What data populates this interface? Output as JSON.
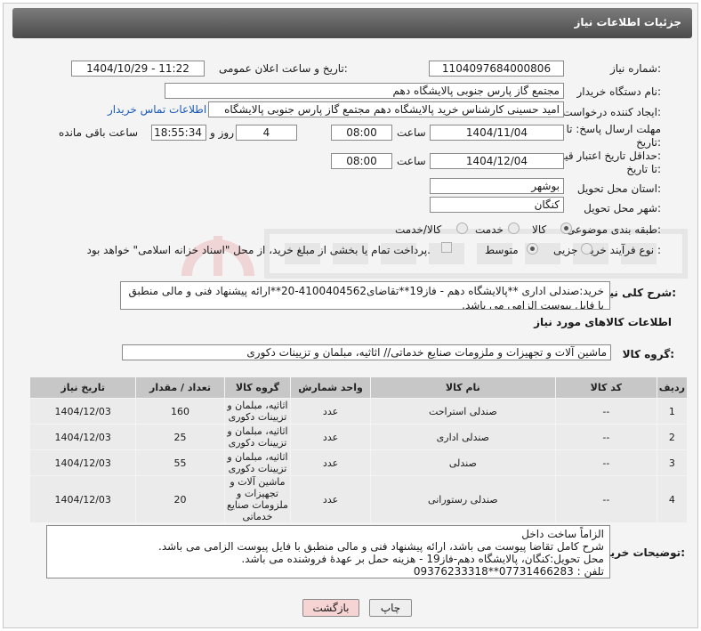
{
  "header": {
    "title": "جزئیات اطلاعات نیاز"
  },
  "form": {
    "need_number": {
      "label": "شماره نیاز:",
      "value": "1104097684000806"
    },
    "announce_datetime": {
      "label": "تاریخ و ساعت اعلان عمومی:",
      "value": "1404/10/29 - 11:22"
    },
    "buyer_org": {
      "label": "نام دستگاه خریدار:",
      "value": "مجتمع گاز پارس جنوبی  پالایشگاه دهم"
    },
    "requester": {
      "label": "ایجاد کننده درخواست:",
      "value": "امید حسینی کارشناس خرید پالایشگاه دهم  مجتمع گاز پارس جنوبی  پالایشگاه",
      "contact_link": "اطلاعات تماس خریدار"
    },
    "reply_deadline": {
      "label_line1": "مهلت ارسال پاسخ: تا",
      "label_line2": "تاریخ:",
      "date": "1404/11/04",
      "time_label": "ساعت",
      "time": "08:00",
      "days": "4",
      "days_label": "روز و",
      "remaining": "18:55:34",
      "remaining_label": "ساعت باقی مانده"
    },
    "price_validity": {
      "label_line1": "حداقل تاریخ اعتبار قیمت:",
      "label_line2": "تا تاریخ:",
      "date": "1404/12/04",
      "time_label": "ساعت",
      "time": "08:00"
    },
    "province": {
      "label": "استان محل تحویل:",
      "value": "بوشهر"
    },
    "city": {
      "label": "شهر محل تحویل:",
      "value": "کنگان"
    },
    "category": {
      "label": "طبقه بندی موضوعی:",
      "options": [
        "کالا",
        "خدمت",
        "کالا/خدمت"
      ],
      "selected": "کالا"
    },
    "process_type": {
      "label": "نوع فرآیند خرید :",
      "options": [
        "جزیی",
        "متوسط"
      ],
      "selected": "متوسط",
      "payment_note": "پرداخت تمام یا بخشی از مبلغ خرید، از محل \"اسناد خزانه اسلامی\" خواهد بود."
    }
  },
  "summary": {
    "label": "شرح کلی نیاز:",
    "text": "خرید:صندلی اداری **پالایشگاه دهم - فاز19**تقاضای4100404562-20**ارائه پیشنهاد فنی و مالی منطبق با فایل پیوست الزامی می باشد."
  },
  "goods_info": {
    "title": "اطلاعات کالاهای مورد نیاز"
  },
  "goods_group": {
    "label": "گروه کالا:",
    "value": "ماشین آلات و تجهیزات و ملزومات صنایع خدماتی// اثاثیه، مبلمان و تزیینات دکوری"
  },
  "table": {
    "headers": [
      "ردیف",
      "کد کالا",
      "نام کالا",
      "واحد شمارش",
      "گروه کالا",
      "تعداد / مقدار",
      "تاریخ نیاز"
    ],
    "rows": [
      {
        "row": "1",
        "code": "--",
        "name": "صندلی استراحت",
        "unit": "عدد",
        "group": "اثاثیه، مبلمان و تزیینات دکوری",
        "qty": "160",
        "date": "1404/12/03"
      },
      {
        "row": "2",
        "code": "--",
        "name": "صندلی اداری",
        "unit": "عدد",
        "group": "اثاثیه، مبلمان و تزیینات دکوری",
        "qty": "25",
        "date": "1404/12/03"
      },
      {
        "row": "3",
        "code": "--",
        "name": "صندلی",
        "unit": "عدد",
        "group": "اثاثیه، مبلمان و تزیینات دکوری",
        "qty": "55",
        "date": "1404/12/03"
      },
      {
        "row": "4",
        "code": "--",
        "name": "صندلی رستورانی",
        "unit": "عدد",
        "group": "ماشین آلات و تجهیزات و ملزومات صنایع خدماتی",
        "qty": "20",
        "date": "1404/12/03"
      }
    ]
  },
  "buyer_notes": {
    "label": "توضیحات خریدار:",
    "lines": [
      "الزاماً ساخت داخل",
      "شرح کامل تقاضا پیوست می باشد، ارائه پیشنهاد فنی و مالی منطبق با فایل پیوست الزامی می باشد.",
      "محل تحویل:کنگان، پالایشگاه دهم-فاز19 - هزینه حمل بر عهدهٔ فروشنده می باشد.",
      "تلفن : 07731466283**09376233318"
    ]
  },
  "buttons": {
    "print": "چاپ",
    "back": "بازگشت"
  },
  "colors": {
    "header": "#5a5a5a",
    "link": "#1a5bb8",
    "back_button": "#f7d4d4"
  }
}
